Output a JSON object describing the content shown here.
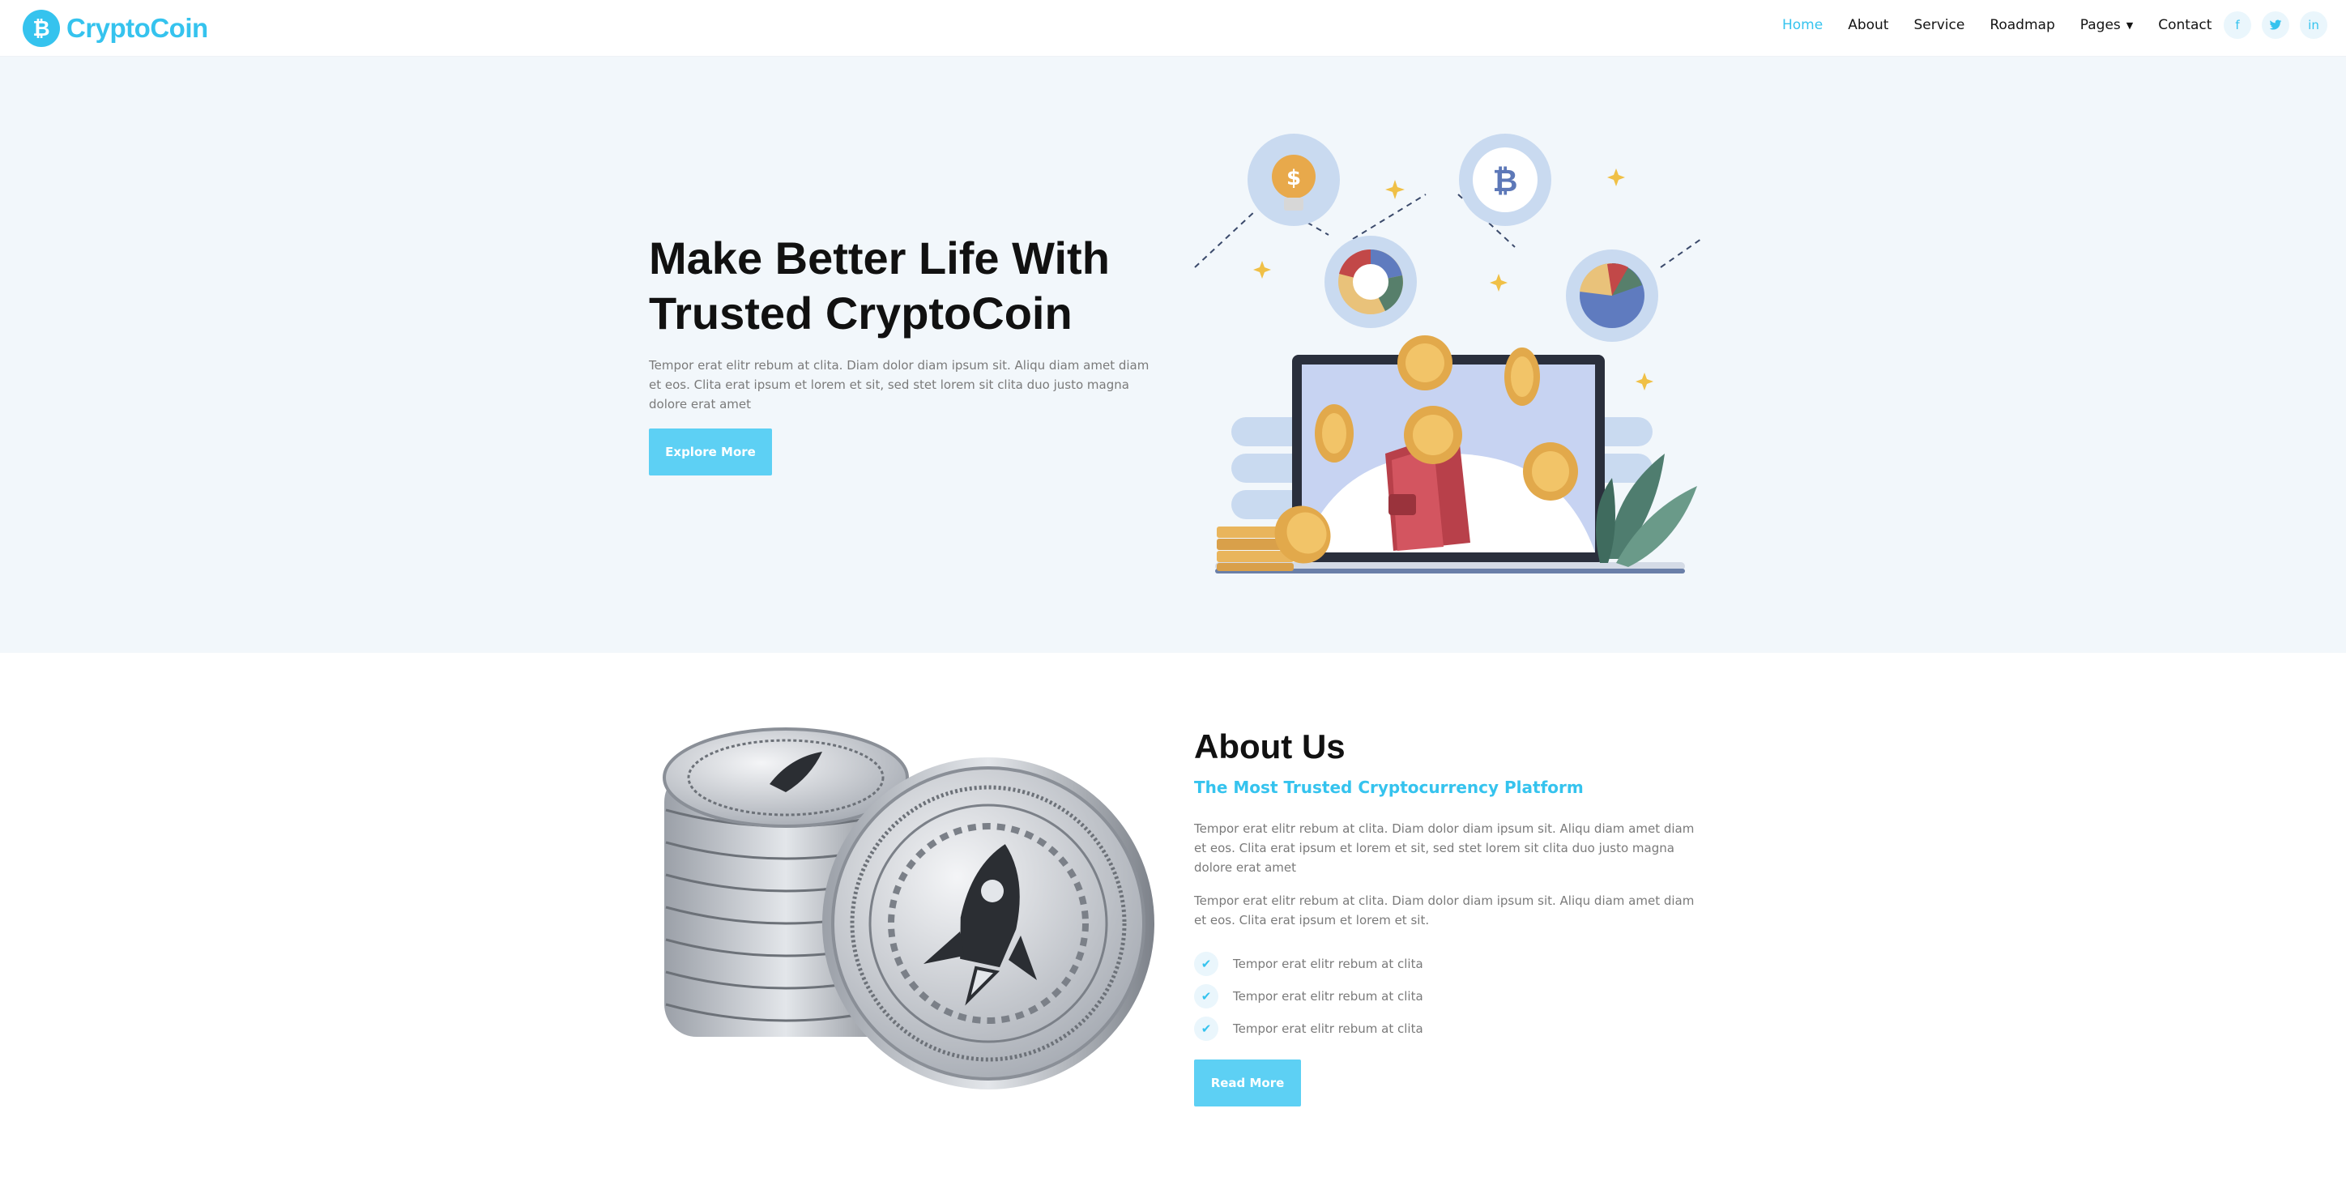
{
  "brand": {
    "name": "CryptoCoin",
    "icon": "bitcoin-icon",
    "color": "#35c3ee"
  },
  "nav": {
    "items": [
      {
        "label": "Home",
        "active": true
      },
      {
        "label": "About"
      },
      {
        "label": "Service"
      },
      {
        "label": "Roadmap"
      },
      {
        "label": "Pages",
        "has_dropdown": true
      },
      {
        "label": "Contact"
      }
    ],
    "socials": [
      {
        "icon": "facebook-icon",
        "glyph": "f"
      },
      {
        "icon": "twitter-icon",
        "glyph": "🐦"
      },
      {
        "icon": "linkedin-icon",
        "glyph": "in"
      }
    ]
  },
  "hero": {
    "title_line1": "Make Better Life With",
    "title_line2": "Trusted CryptoCoin",
    "text": "Tempor erat elitr rebum at clita. Diam dolor diam ipsum sit. Aliqu diam amet diam et eos. Clita erat ipsum et lorem et sit, sed stet lorem sit clita duo justo magna dolore erat amet",
    "button": "Explore More"
  },
  "about": {
    "title": "About Us",
    "subtitle": "The Most Trusted Cryptocurrency Platform",
    "paragraph1": "Tempor erat elitr rebum at clita. Diam dolor diam ipsum sit. Aliqu diam amet diam et eos. Clita erat ipsum et lorem et sit, sed stet lorem sit clita duo justo magna dolore erat amet",
    "paragraph2": "Tempor erat elitr rebum at clita. Diam dolor diam ipsum sit. Aliqu diam amet diam et eos. Clita erat ipsum et lorem et sit.",
    "checklist": [
      "Tempor erat elitr rebum at clita",
      "Tempor erat elitr rebum at clita",
      "Tempor erat elitr rebum at clita"
    ],
    "button": "Read More"
  },
  "colors": {
    "accent": "#35c3ee",
    "button": "#5dd0f4",
    "hero_bg": "#f2f7fb"
  }
}
